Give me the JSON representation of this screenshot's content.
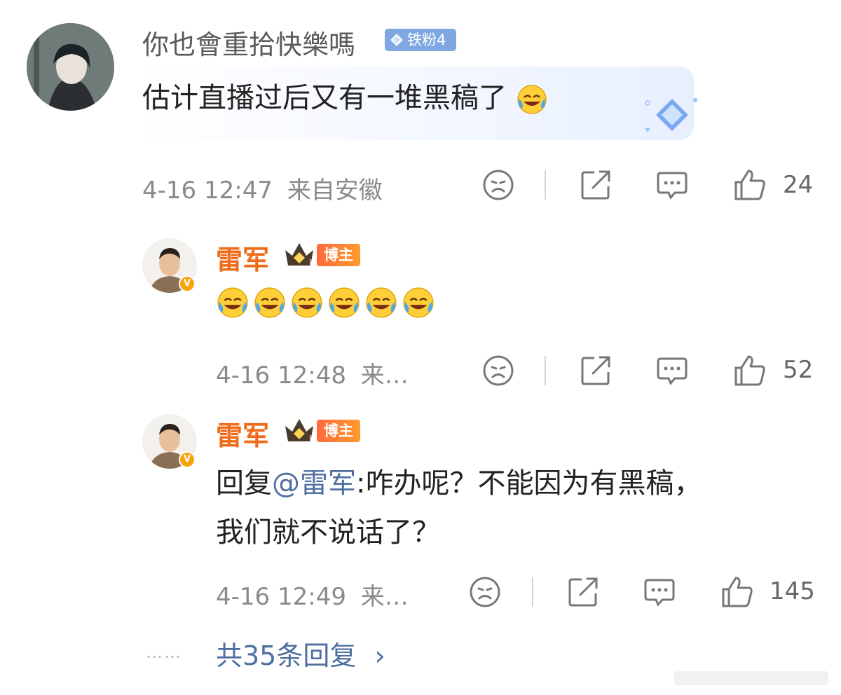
{
  "comment": {
    "user": {
      "name": "你也會重拾快樂嗎",
      "fan_badge": "铁粉4"
    },
    "text": "估计直播过后又有一堆黑稿了",
    "time": "4-16 12:47",
    "location": "来自安徽",
    "likes": "24"
  },
  "replies": [
    {
      "user": {
        "name": "雷军",
        "role_badge": "博主",
        "crown_level": "II"
      },
      "time": "4-16 12:48",
      "location": "来…",
      "likes": "52",
      "emoji_count": 6
    },
    {
      "user": {
        "name": "雷军",
        "role_badge": "博主",
        "crown_level": "II"
      },
      "text_prefix": "回复",
      "mention": "@雷军",
      "text_line1": ":咋办呢？不能因为有黑稿，",
      "text_line2": "我们就不说话了？",
      "time": "4-16 12:49",
      "location": "来…",
      "likes": "145"
    }
  ],
  "more_replies": {
    "dots": "……",
    "label": "共35条回复",
    "chevron": "›"
  },
  "icons": [
    "dislike-icon",
    "share-icon",
    "comment-icon",
    "like-icon",
    "emoji-laugh-cry-icon",
    "verified-badge-icon",
    "crown-icon",
    "diamond-icon"
  ],
  "colors": {
    "accent_orange": "#f06b19",
    "link_blue": "#4f6fa0",
    "fan_badge": "#7fa7e2",
    "meta_gray": "#8a8a8a"
  }
}
